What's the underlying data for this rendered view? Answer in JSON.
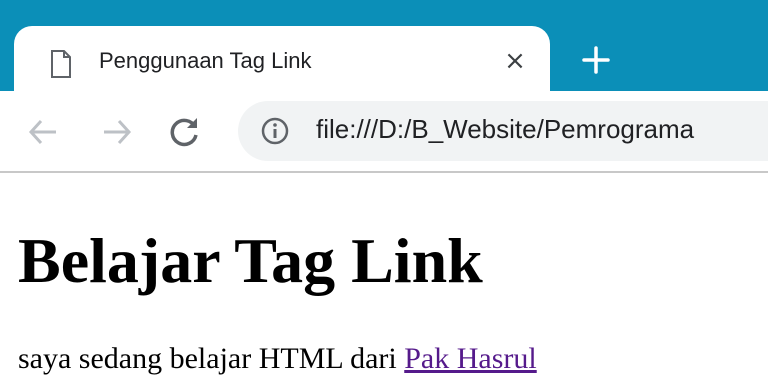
{
  "tab": {
    "title": "Penggunaan Tag Link",
    "icon": "document-icon",
    "close_label": "×"
  },
  "toolbar": {
    "back_icon": "back-arrow-icon",
    "forward_icon": "forward-arrow-icon",
    "reload_icon": "reload-icon",
    "info_icon": "info-icon",
    "url": "file:///D:/B_Website/Pemrograma"
  },
  "page": {
    "heading": "Belajar Tag Link",
    "paragraph_text": "saya sedang belajar HTML dari ",
    "link_text": "Pak Hasrul"
  },
  "colors": {
    "tabbar": "#0b8fb8",
    "link_visited": "#551a8b",
    "omnibox": "#f1f3f4"
  }
}
